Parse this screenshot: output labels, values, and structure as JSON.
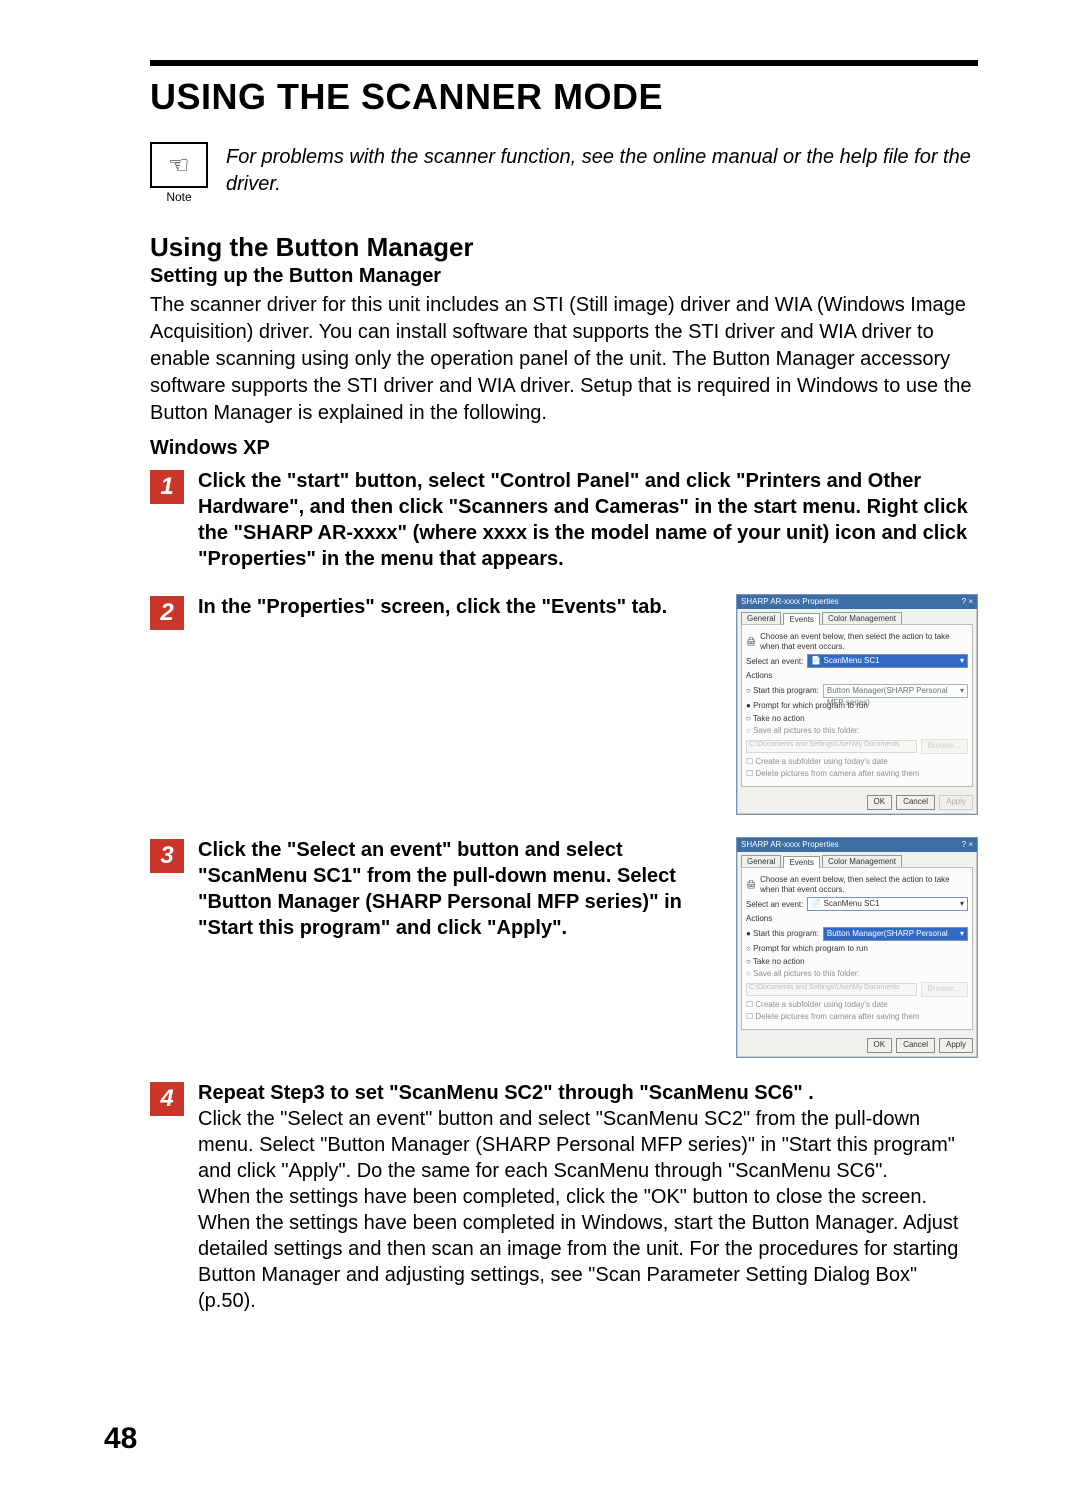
{
  "page_number": "48",
  "rule_present": true,
  "h1": "USING THE SCANNER MODE",
  "note": {
    "icon_semantic": "pointing-hand",
    "label": "Note",
    "text": "For problems with the scanner function, see the online manual or the help file for the driver."
  },
  "h2": "Using the Button Manager",
  "h3": "Setting up the Button Manager",
  "intro_para": "The scanner driver for this unit includes an STI (Still image) driver and WIA (Windows Image Acquisition) driver. You can install software that supports the STI driver and WIA driver to enable scanning using only the operation panel of the unit. The Button Manager accessory software supports the STI driver and WIA driver. Setup that is required in Windows to use the Button Manager is explained in the following.",
  "h4": "Windows XP",
  "steps": [
    {
      "num": "1",
      "title": "Click the \"start\" button, select \"Control Panel\" and click \"Printers and Other Hardware\", and then click \"Scanners and Cameras\" in the start menu. Right click the \"SHARP AR-xxxx\" (where xxxx is the model name of your unit) icon and click \"Properties\" in the menu that appears.",
      "body": "",
      "dialog": null
    },
    {
      "num": "2",
      "title": "In the \"Properties\" screen, click the \"Events\" tab.",
      "body": "",
      "dialog": {
        "title": "SHARP AR-xxxx Properties",
        "tabs": [
          "General",
          "Events",
          "Color Management"
        ],
        "active_tab": "Events",
        "hint": "Choose an event below, then select the action to take when that event occurs.",
        "select_event_label": "Select an event:",
        "select_event_value": "ScanMenu SC1",
        "select_event_highlight": true,
        "actions_label": "Actions",
        "radios": [
          {
            "label": "Start this program:",
            "selected": false,
            "value": "Button Manager(SHARP Personal MFP series)",
            "value_highlight": false,
            "value_disabled": true
          },
          {
            "label": "Prompt for which program to run",
            "selected": true
          },
          {
            "label": "Take no action",
            "selected": false
          }
        ],
        "save_group_label": "Save all pictures to this folder:",
        "save_group_enabled": false,
        "save_path": "C:\\Documents and Settings\\User\\My Documents",
        "browse": "Browse...",
        "sub_checks": [
          "Create a subfolder using today's date",
          "Delete pictures from camera after saving them"
        ],
        "buttons": [
          "OK",
          "Cancel",
          "Apply"
        ],
        "apply_disabled": true
      }
    },
    {
      "num": "3",
      "title": "Click the \"Select an event\" button and select \"ScanMenu SC1\" from the pull-down menu. Select \"Button Manager (SHARP Personal MFP series)\" in \"Start this program\" and click \"Apply\".",
      "body": "",
      "dialog": {
        "title": "SHARP AR-xxxx Properties",
        "tabs": [
          "General",
          "Events",
          "Color Management"
        ],
        "active_tab": "Events",
        "hint": "Choose an event below, then select the action to take when that event occurs.",
        "select_event_label": "Select an event:",
        "select_event_value": "ScanMenu SC1",
        "select_event_highlight": false,
        "actions_label": "Actions",
        "radios": [
          {
            "label": "Start this program:",
            "selected": true,
            "value": "Button Manager(SHARP Personal MFP series)",
            "value_highlight": true,
            "value_disabled": false
          },
          {
            "label": "Prompt for which program to run",
            "selected": false
          },
          {
            "label": "Take no action",
            "selected": false
          }
        ],
        "save_group_label": "Save all pictures to this folder:",
        "save_group_enabled": false,
        "save_path": "C:\\Documents and Settings\\User\\My Documents",
        "browse": "Browse...",
        "sub_checks": [
          "Create a subfolder using today's date",
          "Delete pictures from camera after saving them"
        ],
        "buttons": [
          "OK",
          "Cancel",
          "Apply"
        ],
        "apply_disabled": false
      }
    },
    {
      "num": "4",
      "title": "Repeat Step3 to set \"ScanMenu SC2\" through \"ScanMenu SC6\" .",
      "body": "Click the \"Select an event\" button and select \"ScanMenu SC2\" from the pull-down menu. Select \"Button Manager (SHARP Personal MFP series)\" in \"Start this program\" and click \"Apply\". Do the same for each ScanMenu through \"ScanMenu SC6\".\nWhen the settings have been completed, click the \"OK\" button to close the screen. When the settings have been completed in Windows, start the Button Manager. Adjust detailed settings and then scan an image from the unit. For the procedures for starting Button Manager and adjusting settings, see \"Scan Parameter Setting Dialog Box\" (p.50).",
      "dialog": null
    }
  ]
}
